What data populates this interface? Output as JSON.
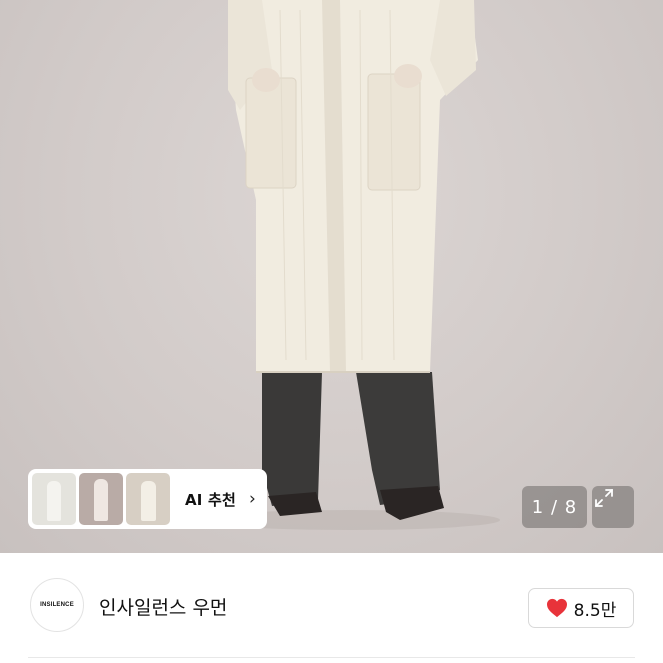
{
  "gallery": {
    "current_page": "1",
    "total_pages": "8",
    "counter_text": "1 / 8",
    "expand_icon": "expand-arrows-icon"
  },
  "ai_recommend": {
    "label": "AI 추천",
    "chevron_icon": "chevron-right-icon",
    "thumbnails": [
      "thumbnail-1",
      "thumbnail-2",
      "thumbnail-3"
    ]
  },
  "brand": {
    "logo_text": "INSILENCE",
    "name": "인사일런스 우먼"
  },
  "like": {
    "icon": "heart-icon",
    "count": "8.5만",
    "color": "#e8333a"
  }
}
